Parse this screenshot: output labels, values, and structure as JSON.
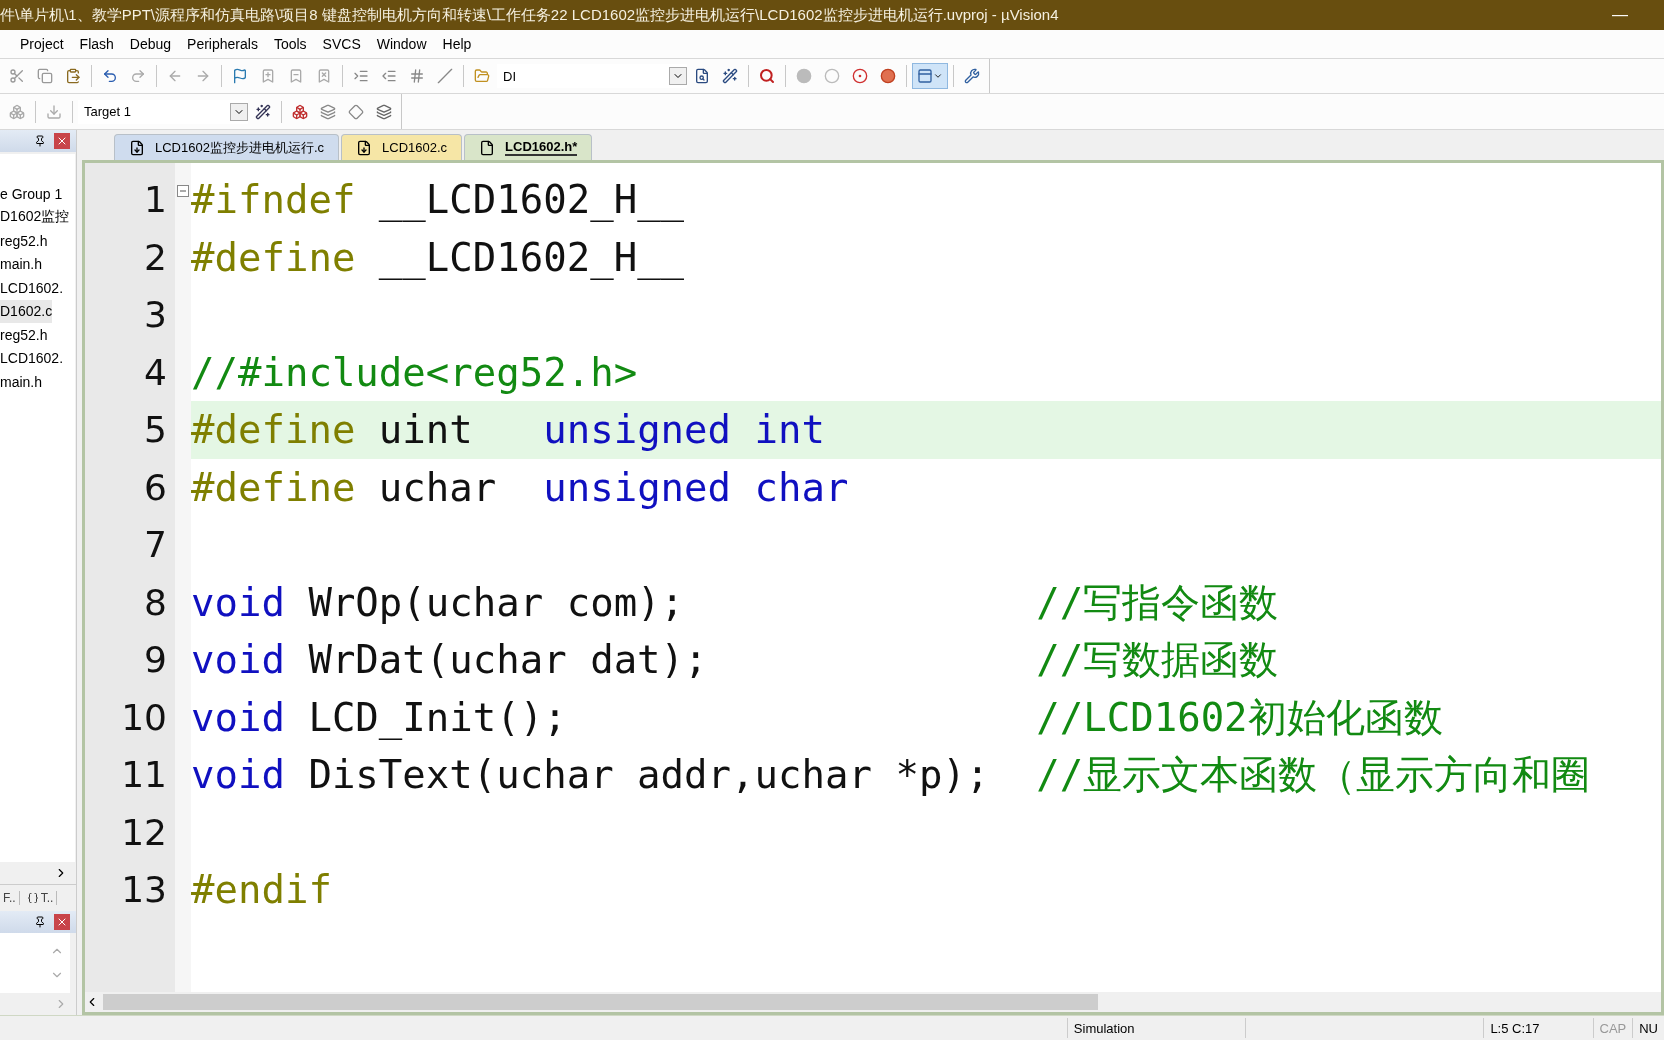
{
  "window": {
    "title": "件\\单片机\\1、教学PPT\\源程序和仿真电路\\项目8  键盘控制电机方向和转速\\工作任务22  LCD1602监控步进电机运行\\LCD1602监控步进电机运行.uvproj - µVision4",
    "minimize": "—"
  },
  "menu": [
    "Project",
    "Flash",
    "Debug",
    "Peripherals",
    "Tools",
    "SVCS",
    "Window",
    "Help"
  ],
  "toolbar": {
    "find_combo": {
      "value": "DI"
    },
    "target_select": {
      "value": "Target 1"
    }
  },
  "project_panel": {
    "items": [
      {
        "label": "e Group 1",
        "selected": false
      },
      {
        "label": "D1602监控",
        "selected": false
      },
      {
        "label": "reg52.h",
        "selected": false
      },
      {
        "label": "main.h",
        "selected": false
      },
      {
        "label": "LCD1602.",
        "selected": false
      },
      {
        "label": "D1602.c",
        "selected": true
      },
      {
        "label": "reg52.h",
        "selected": false
      },
      {
        "label": "LCD1602.",
        "selected": false
      },
      {
        "label": "main.h",
        "selected": false
      }
    ],
    "bottom_tabs": [
      {
        "label": "F..",
        "selected": false
      },
      {
        "label": "T..",
        "selected": false
      }
    ]
  },
  "tabs": [
    {
      "label": "LCD1602监控步进电机运行.c",
      "selected": false,
      "color": "#cfdcee"
    },
    {
      "label": "LCD1602.c",
      "selected": false,
      "color": "#f6e6a6"
    },
    {
      "label": "LCD1602.h*",
      "selected": true,
      "color": "#d9e5c9"
    }
  ],
  "editor": {
    "lines": [
      {
        "number": "1",
        "current": false,
        "code": [
          {
            "kind": "pre",
            "text": "#ifndef"
          },
          {
            "kind": "plain",
            "text": " __LCD1602_H__"
          }
        ]
      },
      {
        "number": "2",
        "current": false,
        "code": [
          {
            "kind": "pre",
            "text": "#define"
          },
          {
            "kind": "plain",
            "text": " __LCD1602_H__"
          }
        ]
      },
      {
        "number": "3",
        "current": false
      },
      {
        "number": "4",
        "current": false,
        "comment": "//#include<reg52.h>"
      },
      {
        "number": "5",
        "current": true,
        "code": [
          {
            "kind": "pre",
            "text": "#define"
          },
          {
            "kind": "plain",
            "text": " uint   "
          },
          {
            "kind": "keyword",
            "text": "unsigned int"
          }
        ]
      },
      {
        "number": "6",
        "current": false,
        "code": [
          {
            "kind": "pre",
            "text": "#define"
          },
          {
            "kind": "plain",
            "text": " uchar  "
          },
          {
            "kind": "keyword",
            "text": "unsigned char"
          }
        ]
      },
      {
        "number": "7",
        "current": false
      },
      {
        "number": "8",
        "current": false,
        "code": [
          {
            "kind": "keyword",
            "text": "void"
          },
          {
            "kind": "plain",
            "text": " WrOp(uchar com);"
          }
        ],
        "comment": "//写指令函数"
      },
      {
        "number": "9",
        "current": false,
        "code": [
          {
            "kind": "keyword",
            "text": "void"
          },
          {
            "kind": "plain",
            "text": " WrDat(uchar dat);"
          }
        ],
        "comment": "//写数据函数"
      },
      {
        "number": "10",
        "current": false,
        "code": [
          {
            "kind": "keyword",
            "text": "void"
          },
          {
            "kind": "plain",
            "text": " LCD_Init();"
          }
        ],
        "comment": "//LCD1602初始化函数"
      },
      {
        "number": "11",
        "current": false,
        "code": [
          {
            "kind": "keyword",
            "text": "void"
          },
          {
            "kind": "plain",
            "text": " DisText(uchar addr,uchar *p);"
          }
        ],
        "comment": "//显示文本函数（显示方向和圈"
      },
      {
        "number": "12",
        "current": false
      },
      {
        "number": "13",
        "current": false,
        "code": [
          {
            "kind": "pre",
            "text": "#endif"
          }
        ]
      }
    ]
  },
  "status_bar": {
    "mode": "Simulation",
    "position": "L:5 C:17",
    "indicators": [
      {
        "label": "CAP",
        "on": false
      },
      {
        "label": "NU",
        "on": true
      }
    ]
  }
}
